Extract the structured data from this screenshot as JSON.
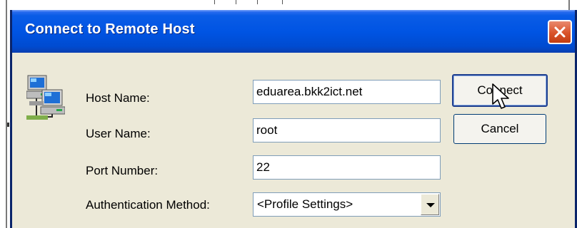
{
  "dialog": {
    "title": "Connect to Remote Host",
    "close_icon": "close-icon"
  },
  "icons": {
    "host": "networked-computers-icon",
    "cursor": "mouse-pointer-icon"
  },
  "fields": {
    "host_name_label": "Host Name:",
    "host_name_value": "eduarea.bkk2ict.net",
    "user_name_label": "User Name:",
    "user_name_value": "root",
    "port_number_label": "Port Number:",
    "port_number_value": "22",
    "auth_method_label": "Authentication Method:",
    "auth_method_value": "<Profile Settings>"
  },
  "buttons": {
    "connect": "Connect",
    "cancel": "Cancel"
  },
  "colors": {
    "titlebar": "#0054e3",
    "dialog_bg": "#ece9d8",
    "close_button": "#d9532a"
  }
}
